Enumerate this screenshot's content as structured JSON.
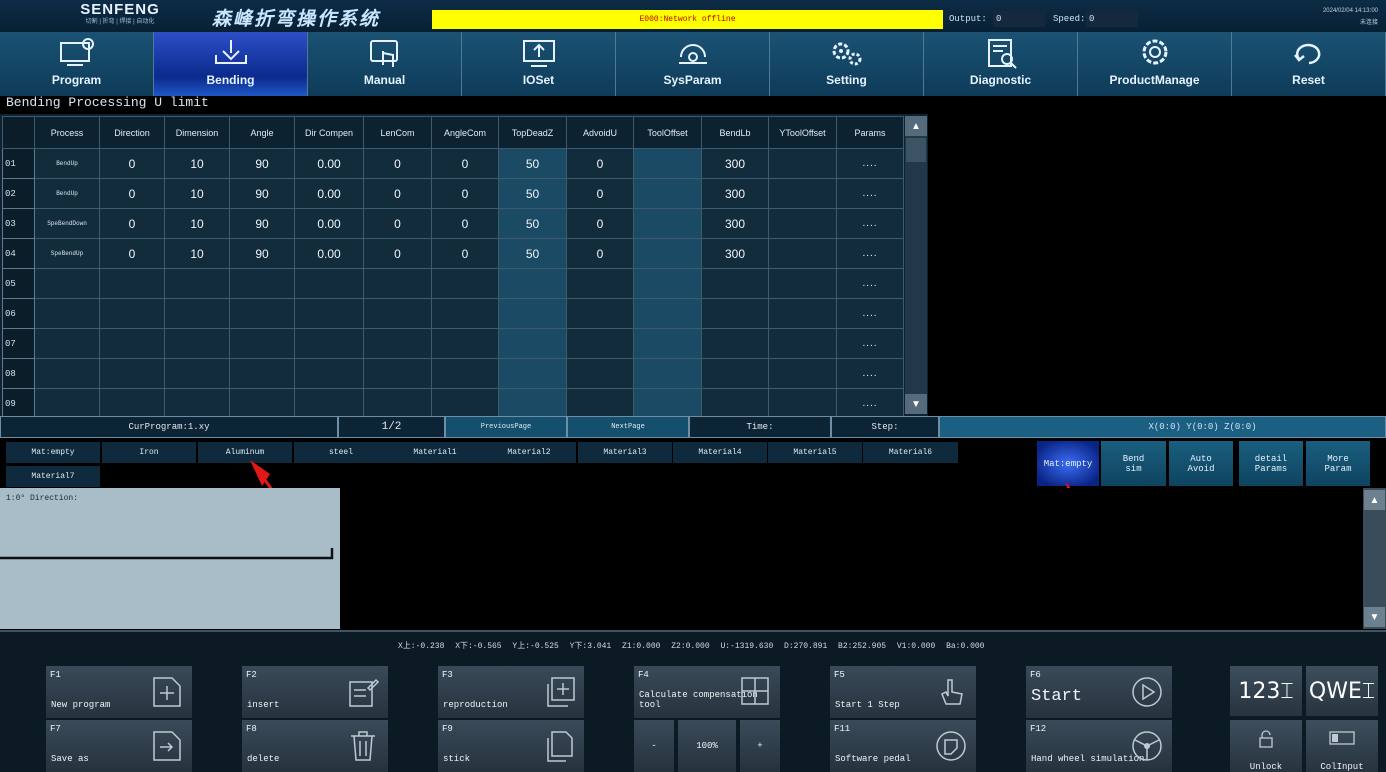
{
  "header": {
    "brand": "SENFENG",
    "brand_sub": "切割 | 折弯 | 焊接 | 自动化",
    "system_title": "森峰折弯操作系统",
    "alarm": "E000:Network offline",
    "output_label": "Output:",
    "output_value": "0",
    "speed_label": "Speed:",
    "speed_value": "0",
    "date": "2024/02/04 14:13:00",
    "user": "未连接"
  },
  "nav": [
    {
      "label": "Program",
      "icon": "program-icon"
    },
    {
      "label": "Bending",
      "icon": "bending-icon",
      "active": true
    },
    {
      "label": "Manual",
      "icon": "manual-icon"
    },
    {
      "label": "IOSet",
      "icon": "ioset-icon"
    },
    {
      "label": "SysParam",
      "icon": "sysparam-icon"
    },
    {
      "label": "Setting",
      "icon": "gears-icon"
    },
    {
      "label": "Diagnostic",
      "icon": "diagnostic-icon"
    },
    {
      "label": "ProductManage",
      "icon": "productmanage-icon"
    },
    {
      "label": "Reset",
      "icon": "reset-icon"
    }
  ],
  "page_title": "Bending Processing U limit",
  "table": {
    "columns": [
      "Process",
      "Direction",
      "Dimension",
      "Angle",
      "Dir Compen",
      "LenCom",
      "AngleCom",
      "TopDeadZ",
      "AdvoidU",
      "ToolOffset",
      "BendLb",
      "YToolOffset",
      "Params"
    ],
    "rows": [
      {
        "num": "01",
        "cells": [
          "BendUp",
          "0",
          "10",
          "90",
          "0.00",
          "0",
          "0",
          "50",
          "0",
          "",
          "300",
          "",
          "...."
        ]
      },
      {
        "num": "02",
        "cells": [
          "BendUp",
          "0",
          "10",
          "90",
          "0.00",
          "0",
          "0",
          "50",
          "0",
          "",
          "300",
          "",
          "...."
        ]
      },
      {
        "num": "03",
        "cells": [
          "SpeBendDown",
          "0",
          "10",
          "90",
          "0.00",
          "0",
          "0",
          "50",
          "0",
          "",
          "300",
          "",
          "...."
        ]
      },
      {
        "num": "04",
        "cells": [
          "SpeBendUp",
          "0",
          "10",
          "90",
          "0.00",
          "0",
          "0",
          "50",
          "0",
          "",
          "300",
          "",
          "...."
        ]
      },
      {
        "num": "05",
        "cells": [
          "",
          "",
          "",
          "",
          "",
          "",
          "",
          "",
          "",
          "",
          "",
          "",
          "...."
        ]
      },
      {
        "num": "06",
        "cells": [
          "",
          "",
          "",
          "",
          "",
          "",
          "",
          "",
          "",
          "",
          "",
          "",
          "...."
        ]
      },
      {
        "num": "07",
        "cells": [
          "",
          "",
          "",
          "",
          "",
          "",
          "",
          "",
          "",
          "",
          "",
          "",
          "...."
        ]
      },
      {
        "num": "08",
        "cells": [
          "",
          "",
          "",
          "",
          "",
          "",
          "",
          "",
          "",
          "",
          "",
          "",
          "...."
        ]
      },
      {
        "num": "09",
        "cells": [
          "",
          "",
          "",
          "",
          "",
          "",
          "",
          "",
          "",
          "",
          "",
          "",
          "...."
        ]
      }
    ]
  },
  "status": {
    "cur_program": "CurProgram:1.xy",
    "page": "1/2",
    "previous_page": "PreviousPage",
    "next_page": "NextPage",
    "time": "Time:",
    "step": "Step:",
    "coords": "X(0:0) Y(0:0) Z(0:0)"
  },
  "materials": [
    "Mat:empty",
    "Iron",
    "Aluminum",
    "steel",
    "Material1",
    "Material2",
    "Material3",
    "Material4",
    "Material5",
    "Material6",
    "Material7"
  ],
  "right_buttons": [
    {
      "label": "Mat:empty",
      "active": true
    },
    {
      "label": "Bend sim"
    },
    {
      "label": "Auto Avoid"
    },
    {
      "label": "detail Params"
    },
    {
      "label": "More Param"
    }
  ],
  "preview": {
    "label": "1:0° Direction:"
  },
  "axis_readout": "X上:-0.238  X下:-0.565  Y上:-0.525  Y下:3.041  Z1:0.000  Z2:0.000  U:-1319.630  D:270.891  B2:252.905  V1:0.000  Ba:0.000",
  "function_keys": [
    {
      "key": "F1",
      "label": "New program",
      "icon": "add-file-icon"
    },
    {
      "key": "F2",
      "label": "insert",
      "icon": "insert-icon"
    },
    {
      "key": "F3",
      "label": "reproduction",
      "icon": "copy-plus-icon"
    },
    {
      "key": "F4",
      "label": "Calculate compensation tool",
      "icon": "calculator-icon"
    },
    {
      "key": "F5",
      "label": "Start 1 Step",
      "icon": "hand-icon"
    },
    {
      "key": "F6",
      "label": "Start",
      "icon": "play-icon"
    },
    {
      "key": "F7",
      "label": "Save as",
      "icon": "save-as-icon"
    },
    {
      "key": "F8",
      "label": "delete",
      "icon": "trash-icon"
    },
    {
      "key": "F9",
      "label": "stick",
      "icon": "paste-icon"
    },
    {
      "key": "F11",
      "label": "Software pedal",
      "icon": "pedal-icon"
    },
    {
      "key": "F12",
      "label": "Hand wheel simulation",
      "icon": "handwheel-icon"
    }
  ],
  "zoom": {
    "minus": "-",
    "value": "100%",
    "plus": "+"
  },
  "keyboards": {
    "numeric": "123",
    "alpha": "QWE",
    "unlock": "Unlock",
    "colinput": "ColInput"
  }
}
